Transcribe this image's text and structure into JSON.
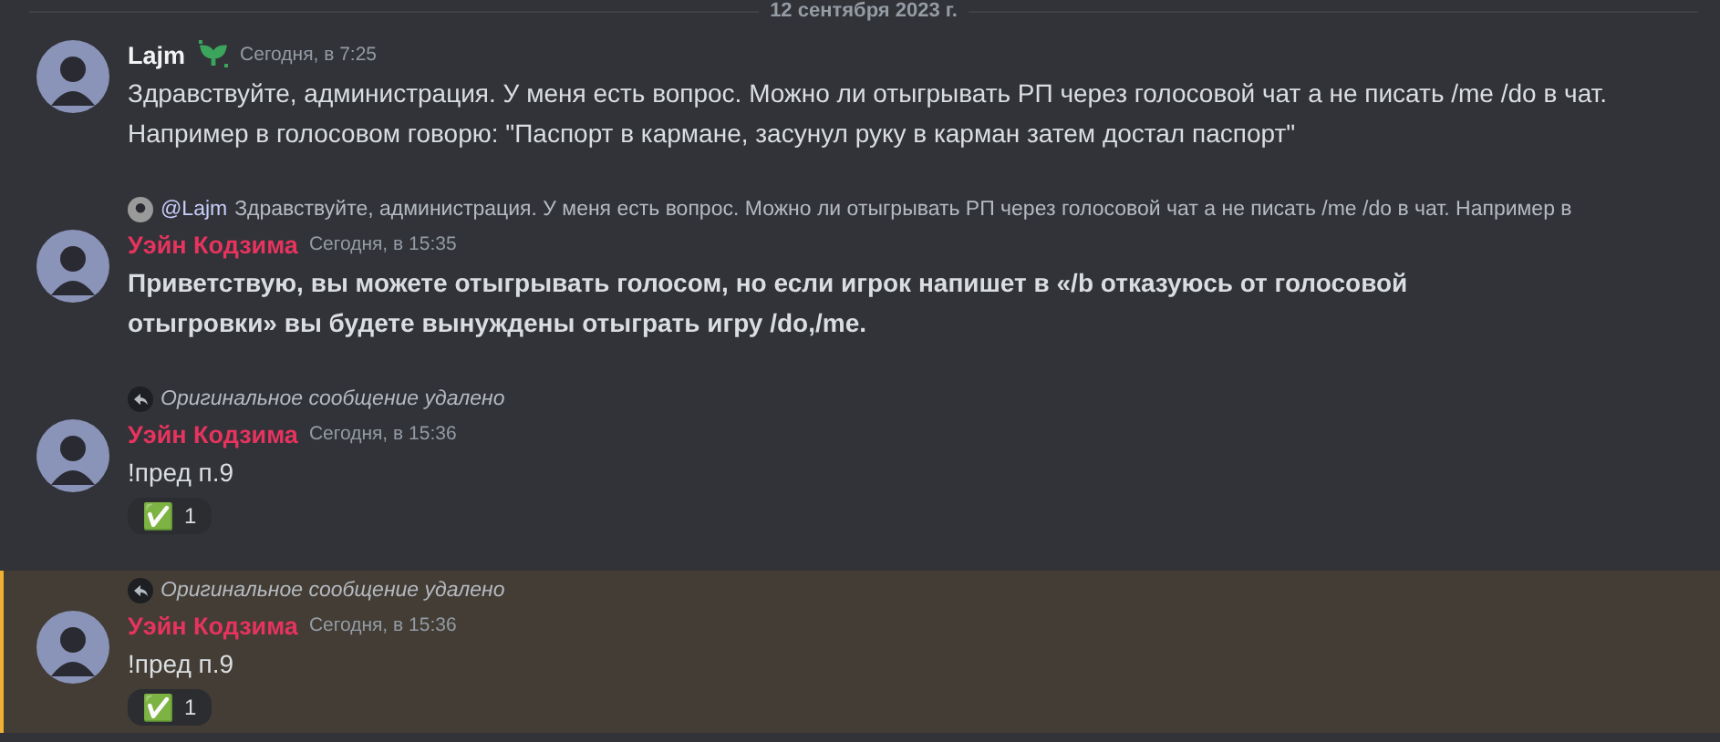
{
  "divider": {
    "label": "12 сентября 2023 г."
  },
  "messages": [
    {
      "author": "Lajm",
      "color": "#f2f3f5",
      "badge": true,
      "time": "Сегодня, в 7:25",
      "text": "Здравствуйте, администрация. У меня есть вопрос. Можно ли отыгрывать РП через голосовой чат а не писать /me /do в чат. Например в голосовом говорю: \"Паспорт в кармане, засунул руку в карман затем достал паспорт\"",
      "bold": false,
      "highlighted": false
    },
    {
      "reply": {
        "kind": "quote",
        "mention": "@Lajm",
        "text": "Здравствуйте, администрация. У меня есть вопрос. Можно ли отыгрывать РП через голосовой чат а не писать /me /do в чат. Например в"
      },
      "author": "Уэйн Кодзима",
      "color": "#e7335e",
      "badge": false,
      "time": "Сегодня, в 15:35",
      "text": "Приветствую, вы можете отыгрывать голосом, но если игрок напишет в «/b отказуюсь от голосовой отыгровки» вы будете вынуждены отыграть игру /do,/me.",
      "bold": true,
      "highlighted": false
    },
    {
      "reply": {
        "kind": "deleted",
        "text": "Оригинальное сообщение удалено"
      },
      "author": "Уэйн Кодзима",
      "color": "#e7335e",
      "badge": false,
      "time": "Сегодня, в 15:36",
      "text": "!пред п.9",
      "bold": false,
      "highlighted": false,
      "reactions": [
        {
          "emoji": "✅",
          "count": "1"
        }
      ]
    },
    {
      "reply": {
        "kind": "deleted",
        "text": "Оригинальное сообщение удалено"
      },
      "author": "Уэйн Кодзима",
      "color": "#e7335e",
      "badge": false,
      "time": "Сегодня, в 15:36",
      "text": "!пред п.9",
      "bold": false,
      "highlighted": true,
      "reactions": [
        {
          "emoji": "✅",
          "count": "1"
        }
      ]
    }
  ]
}
